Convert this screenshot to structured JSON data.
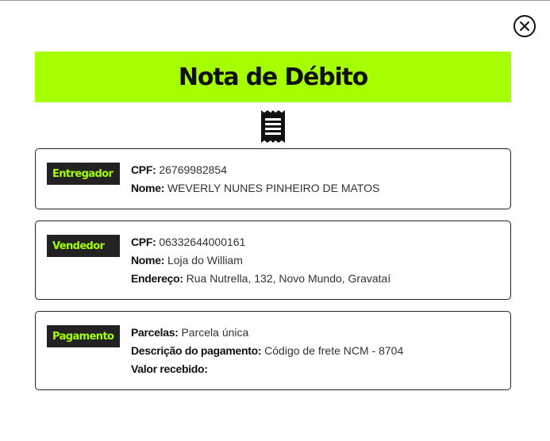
{
  "close_icon": "close-icon",
  "title": "Nota de Débito",
  "receipt_icon": "receipt-icon",
  "colors": {
    "accent": "#a6ff00",
    "label_bg": "#222222",
    "border": "#222222"
  },
  "sections": {
    "entregador": {
      "label": "Entregador",
      "rows": [
        {
          "key": "CPF:",
          "value": "26769982854"
        },
        {
          "key": "Nome:",
          "value": "WEVERLY NUNES PINHEIRO DE MATOS"
        }
      ]
    },
    "vendedor": {
      "label": "Vendedor",
      "rows": [
        {
          "key": "CPF:",
          "value": "06332644000161"
        },
        {
          "key": "Nome:",
          "value": "Loja do William"
        },
        {
          "key": "Endereço:",
          "value": "Rua Nutrella, 132, Novo Mundo, Gravataí"
        }
      ]
    },
    "pagamento": {
      "label": "Pagamento",
      "rows": [
        {
          "key": "Parcelas:",
          "value": "Parcela única"
        },
        {
          "key": "Descrição do pagamento:",
          "value": "Código de frete NCM - 8704"
        },
        {
          "key": "Valor recebido:",
          "value": ""
        }
      ]
    }
  }
}
